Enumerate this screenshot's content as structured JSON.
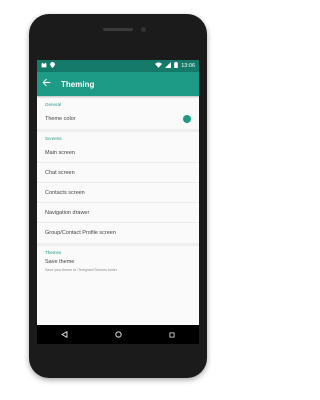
{
  "status_bar": {
    "time": "13:06",
    "icons": [
      "cat-icon",
      "location-icon",
      "wifi-icon",
      "signal-icon",
      "battery-icon"
    ]
  },
  "app_bar": {
    "back_icon": "arrow-back-icon",
    "title": "Theming"
  },
  "sections": {
    "general": {
      "header": "General",
      "theme_color_label": "Theme color",
      "theme_color_value": "#1e9b86"
    },
    "screens": {
      "header": "Screens",
      "items": [
        "Main screen",
        "Chat screen",
        "Contacts screen",
        "Navigation drawer",
        "Group/Contact Profile screen"
      ]
    },
    "themes": {
      "header": "Themes",
      "save_title": "Save theme",
      "save_subtitle": "Save your theme to /Telegram/Themes folder"
    }
  },
  "nav_bar": {
    "icons": [
      "back-triangle-icon",
      "home-circle-icon",
      "recents-square-icon"
    ]
  },
  "colors": {
    "accent": "#1e9b86",
    "status_bar": "#157a6a"
  }
}
